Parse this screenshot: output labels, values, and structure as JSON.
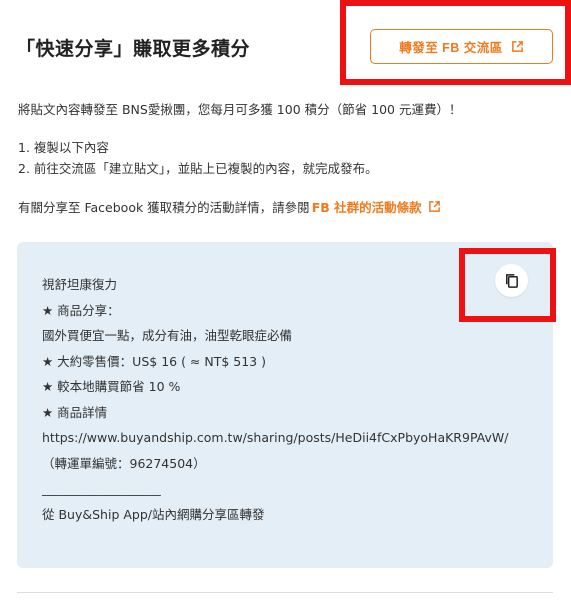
{
  "header": {
    "title": "「快速分享」賺取更多積分",
    "share_button_label": "轉發至 FB 交流區"
  },
  "intro": "將貼文內容轉發至 BNS愛揪團，您每月可多獲 100 積分（節省 100 元運費）！",
  "steps": [
    "1. 複製以下內容",
    "2. 前往交流區「建立貼文」，並貼上已複製的內容，就完成發布。"
  ],
  "terms": {
    "text": "有關分享至 Facebook 獲取積分的活動詳情，請參閱",
    "link_label": "FB 社群的活動條款"
  },
  "card": {
    "lines": [
      "視舒坦康復力",
      "★ 商品分享：",
      "國外買便宜一點，成分有油，油型乾眼症必備",
      "★ 大約零售價：US$ 16 ( ≈ NT$ 513 )",
      "★ 較本地購買節省 10 %",
      "★ 商品詳情"
    ],
    "url": "https://www.buyandship.com.tw/sharing/posts/HeDii4fCxPbyoHaKR9PAvW/",
    "order_number": "（轉運單編號：96274504）",
    "divider": "___________________",
    "footer": "從 Buy&Ship App/站內網購分享區轉發"
  },
  "colors": {
    "accent": "#f07a1e",
    "card_bg": "#e3eef7",
    "highlight": "#ee1111"
  },
  "icons": {
    "share": "external-link-icon",
    "copy": "copy-icon"
  }
}
